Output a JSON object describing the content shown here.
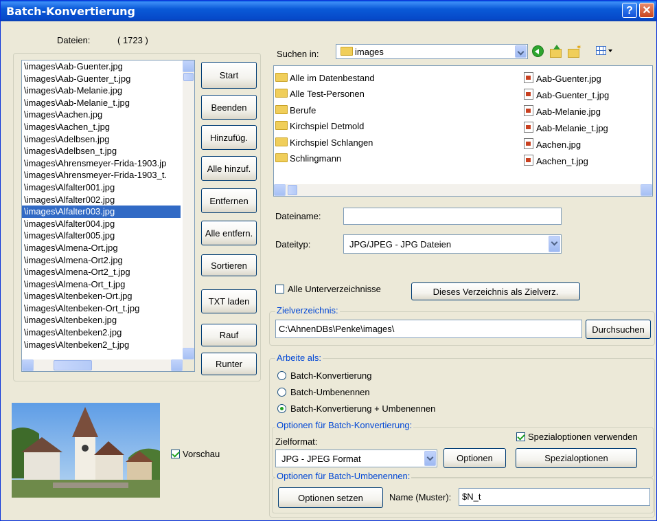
{
  "window": {
    "title": "Batch-Konvertierung"
  },
  "files": {
    "label": "Dateien:",
    "count": "( 1723 )",
    "items": [
      "\\images\\Aab-Guenter.jpg",
      "\\images\\Aab-Guenter_t.jpg",
      "\\images\\Aab-Melanie.jpg",
      "\\images\\Aab-Melanie_t.jpg",
      "\\images\\Aachen.jpg",
      "\\images\\Aachen_t.jpg",
      "\\images\\Adelbsen.jpg",
      "\\images\\Adelbsen_t.jpg",
      "\\images\\Ahrensmeyer-Frida-1903.jp",
      "\\images\\Ahrensmeyer-Frida-1903_t.",
      "\\images\\Alfalter001.jpg",
      "\\images\\Alfalter002.jpg",
      "\\images\\Alfalter003.jpg",
      "\\images\\Alfalter004.jpg",
      "\\images\\Alfalter005.jpg",
      "\\images\\Almena-Ort.jpg",
      "\\images\\Almena-Ort2.jpg",
      "\\images\\Almena-Ort2_t.jpg",
      "\\images\\Almena-Ort_t.jpg",
      "\\images\\Altenbeken-Ort.jpg",
      "\\images\\Altenbeken-Ort_t.jpg",
      "\\images\\Altenbeken.jpg",
      "\\images\\Altenbeken2.jpg",
      "\\images\\Altenbeken2_t.jpg"
    ],
    "selected": "\\images\\Alfalter003.jpg"
  },
  "buttons": {
    "start": "Start",
    "beenden": "Beenden",
    "hinzufuegen": "Hinzufüg.",
    "alle_hinzufuegen": "Alle hinzuf.",
    "entfernen": "Entfernen",
    "alle_entfernen": "Alle entfern.",
    "sortieren": "Sortieren",
    "txt_laden": "TXT laden",
    "rauf": "Rauf",
    "runter": "Runter"
  },
  "preview": {
    "checkbox_label": "Vorschau",
    "checked": true
  },
  "browser": {
    "look_in_label": "Suchen in:",
    "look_in_value": "images",
    "folders": [
      "Alle im Datenbestand",
      "Alle Test-Personen",
      "Berufe",
      "Kirchspiel Detmold",
      "Kirchspiel Schlangen",
      "Schlingmann"
    ],
    "files": [
      "Aab-Guenter.jpg",
      "Aab-Guenter_t.jpg",
      "Aab-Melanie.jpg",
      "Aab-Melanie_t.jpg",
      "Aachen.jpg",
      "Aachen_t.jpg"
    ],
    "filename_label": "Dateiname:",
    "filename_value": "",
    "filetype_label": "Dateityp:",
    "filetype_value": "JPG/JPEG - JPG Dateien",
    "subdirs_label": "Alle Unterverzeichnisse",
    "subdirs_checked": false,
    "set_target_button": "Dieses Verzeichnis als Zielverz."
  },
  "target": {
    "group_label": "Zielverzeichnis:",
    "path": "C:\\AhnenDBs\\Penke\\images\\",
    "browse_button": "Durchsuchen"
  },
  "mode": {
    "group_label": "Arbeite als:",
    "options": [
      "Batch-Konvertierung",
      "Batch-Umbenennen",
      "Batch-Konvertierung + Umbenennen"
    ],
    "selected": "Batch-Konvertierung + Umbenennen"
  },
  "convert_options": {
    "group_label": "Optionen für Batch-Konvertierung:",
    "special_checkbox_label": "Spezialoptionen verwenden",
    "special_checked": true,
    "format_label": "Zielformat:",
    "format_value": "JPG - JPEG Format",
    "options_button": "Optionen",
    "special_button": "Spezialoptionen"
  },
  "rename_options": {
    "group_label": "Optionen für Batch-Umbenennen:",
    "set_button": "Optionen setzen",
    "pattern_label": "Name (Muster):",
    "pattern_value": "$N_t"
  },
  "colors": {
    "titlebar": "#0A5AD8",
    "dialog_bg": "#ECE9D8",
    "selection": "#316AC5",
    "group_label": "#0046D5",
    "check_green": "#21A121"
  }
}
